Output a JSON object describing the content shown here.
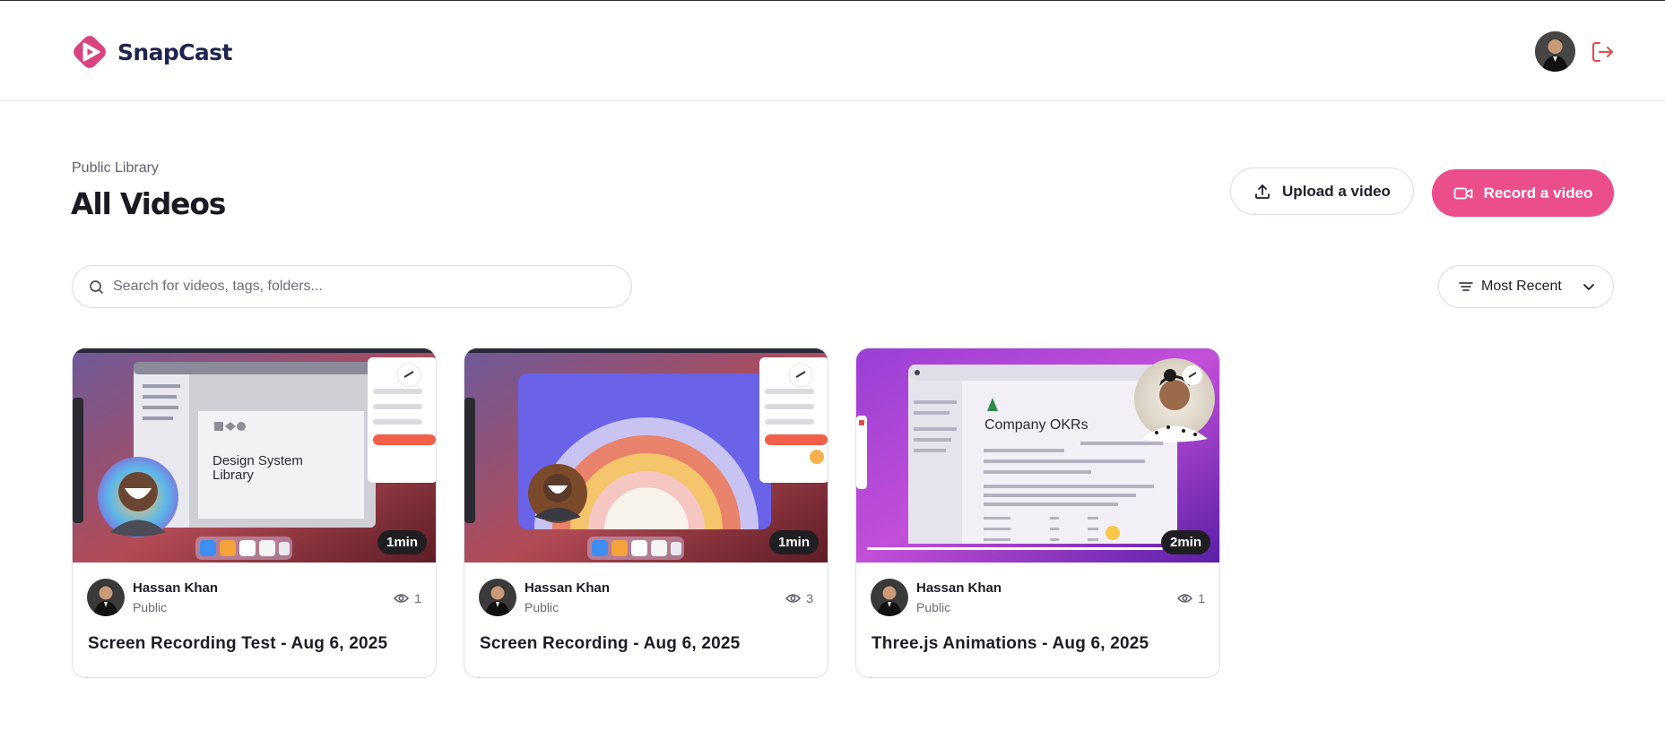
{
  "app": {
    "name": "SnapCast"
  },
  "header": {
    "logout_icon": "logout-icon",
    "avatar_icon": "user-avatar"
  },
  "page": {
    "eyebrow": "Public Library",
    "title": "All Videos"
  },
  "actions": {
    "upload_label": "Upload a video",
    "upload_icon": "upload-icon",
    "record_label": "Record a video",
    "record_icon": "video-camera-icon"
  },
  "search": {
    "placeholder": "Search for videos, tags, folders...",
    "icon": "search-icon"
  },
  "sort": {
    "selected": "Most Recent",
    "icon": "sort-lines-icon",
    "chevron": "chevron-down-icon"
  },
  "videos": [
    {
      "author": "Hassan Khan",
      "visibility": "Public",
      "views": "1",
      "duration": "1min",
      "title": "Screen Recording Test - Aug 6, 2025",
      "thumb_text": "Design System Library"
    },
    {
      "author": "Hassan Khan",
      "visibility": "Public",
      "views": "3",
      "duration": "1min",
      "title": "Screen Recording - Aug 6, 2025"
    },
    {
      "author": "Hassan Khan",
      "visibility": "Public",
      "views": "1",
      "duration": "2min",
      "title": "Three.js Animations - Aug 6, 2025",
      "thumb_text": "Company OKRs"
    }
  ],
  "colors": {
    "accent": "#ec4e8c",
    "brand_text": "#1f2450",
    "logout": "#e5484d"
  }
}
